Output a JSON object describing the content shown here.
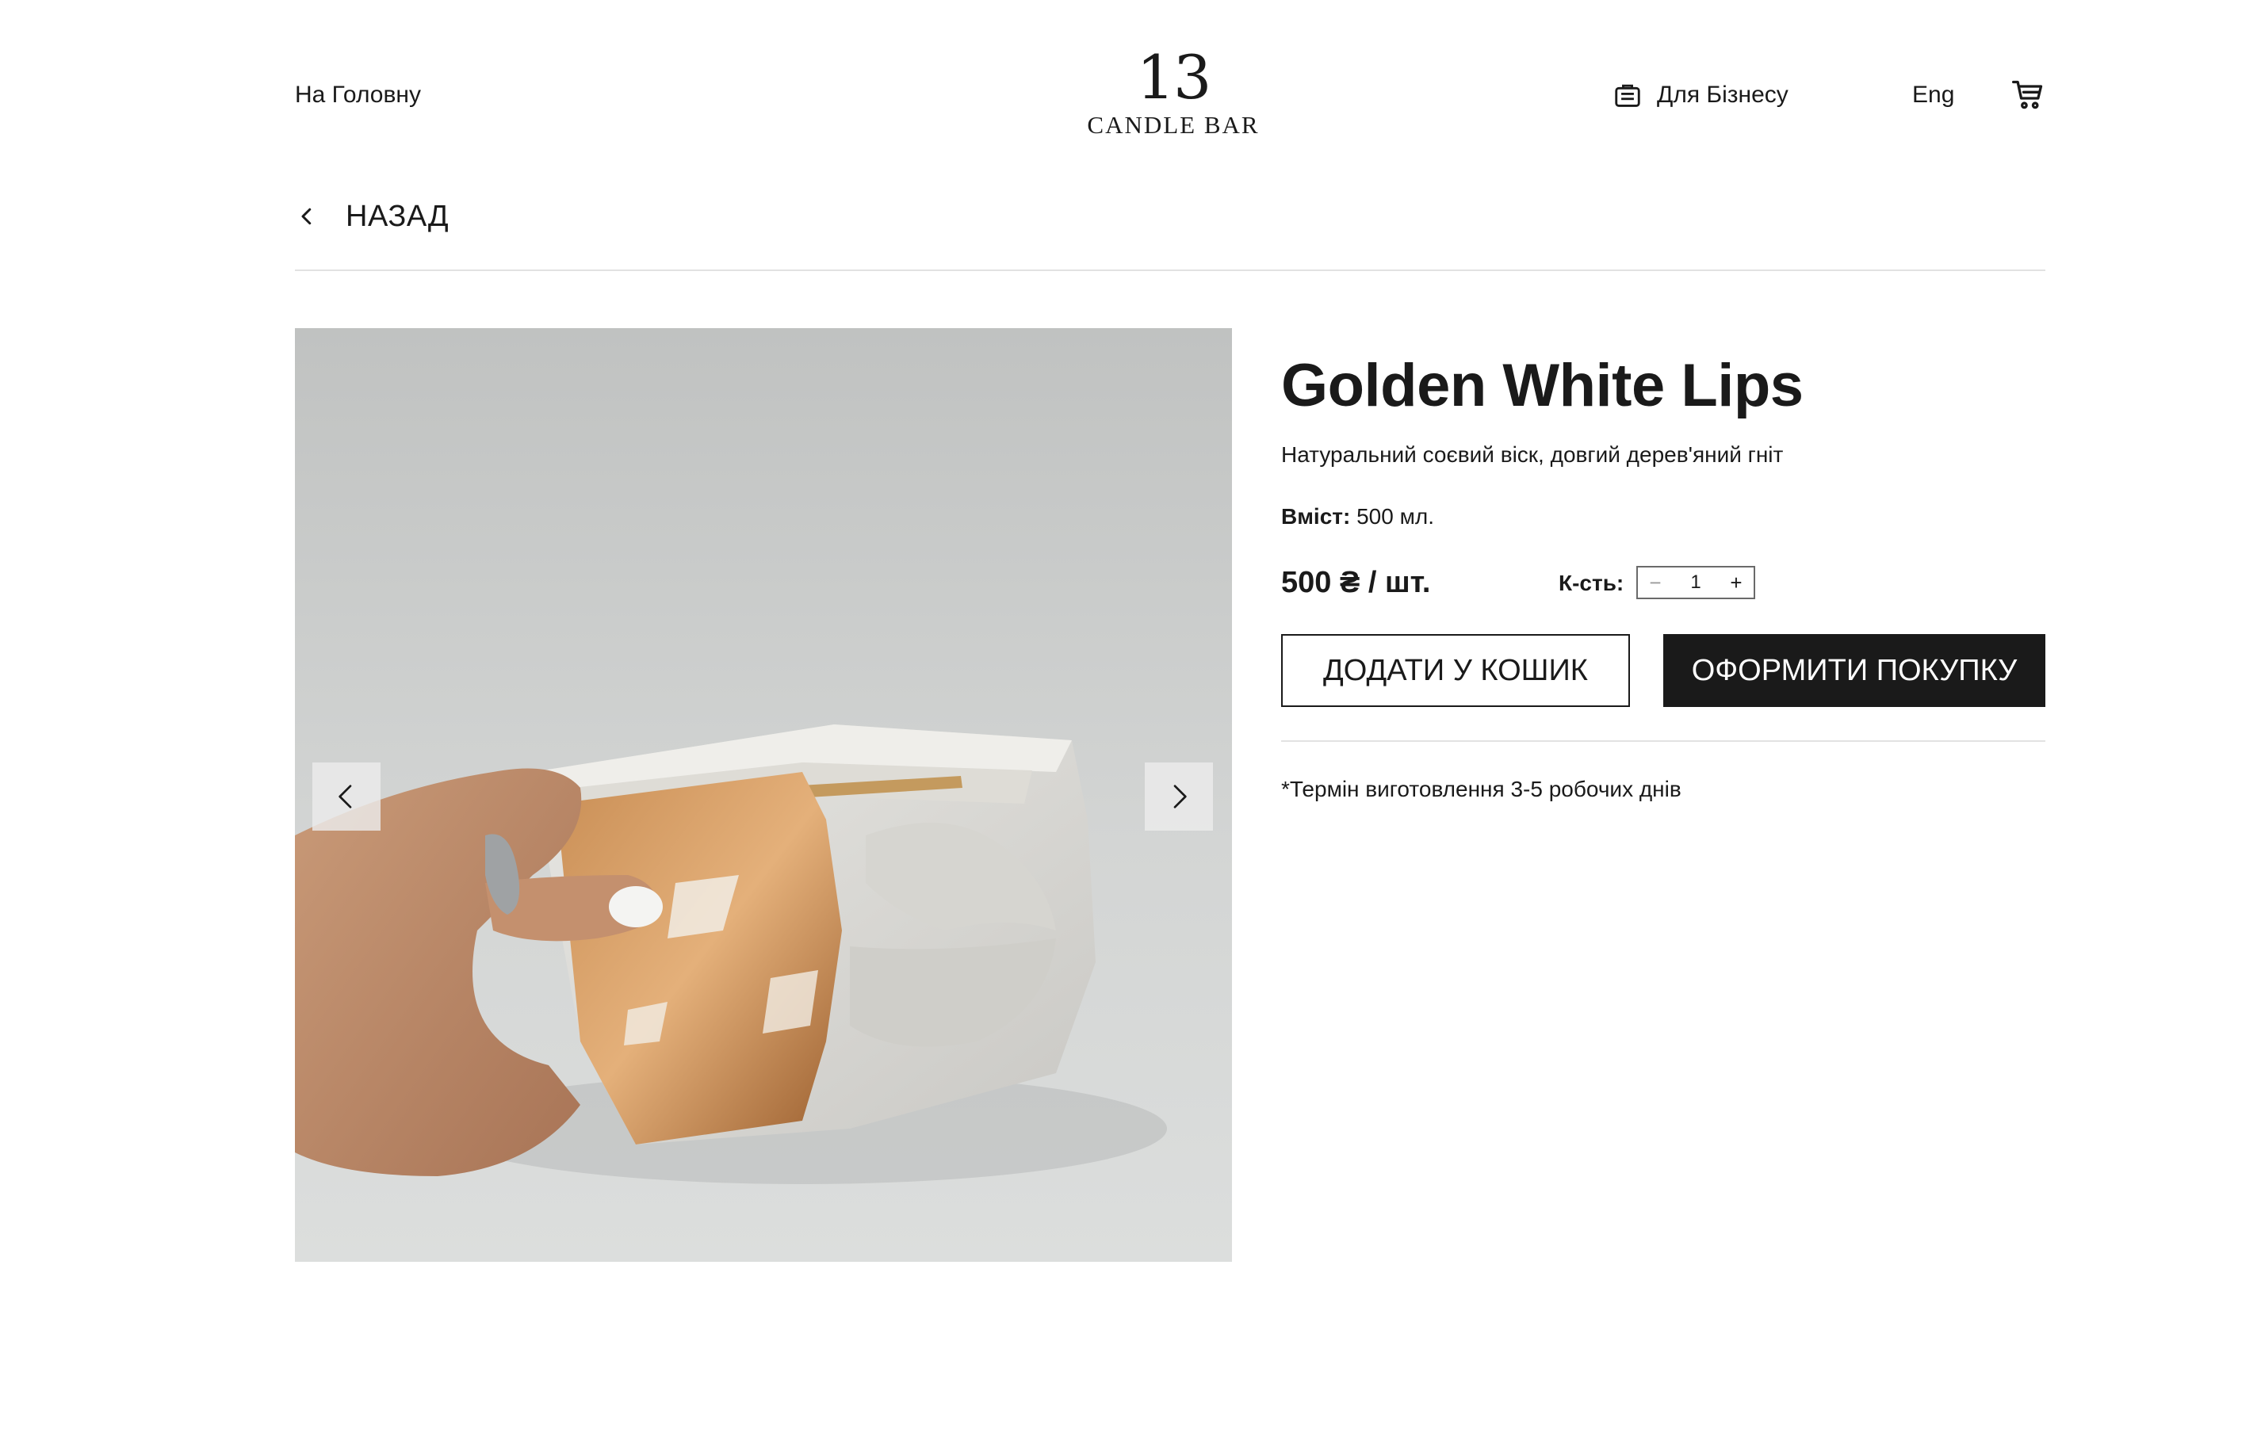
{
  "header": {
    "home_link": "На Головну",
    "logo": {
      "number": "13",
      "text": "CANDLE BAR"
    },
    "business_link": "Для Бізнесу",
    "language": "Eng",
    "icons": {
      "business": "briefcase-icon",
      "cart": "cart-icon"
    }
  },
  "back": {
    "label": "НАЗАД",
    "icon": "chevron-left-icon"
  },
  "gallery": {
    "prev_icon": "chevron-left-icon",
    "next_icon": "chevron-right-icon"
  },
  "product": {
    "title": "Golden White Lips",
    "description": "Натуральний соєвий віск, довгий дерев'яний гніт",
    "volume_label": "Вміст:",
    "volume_value": "500 мл.",
    "price": "500 ₴ / шт.",
    "quantity_label": "К-сть:",
    "quantity": "1",
    "minus": "−",
    "plus": "+",
    "add_to_cart": "ДОДАТИ У КОШИК",
    "checkout": "ОФОРМИТИ ПОКУПКУ",
    "production_note": "*Термін виготовлення 3-5 робочих днів"
  },
  "colors": {
    "text": "#1a1a1a",
    "button_dark": "#1a1a1a",
    "divider": "#e2e2e2",
    "gold_leaf": "#b87a44"
  }
}
